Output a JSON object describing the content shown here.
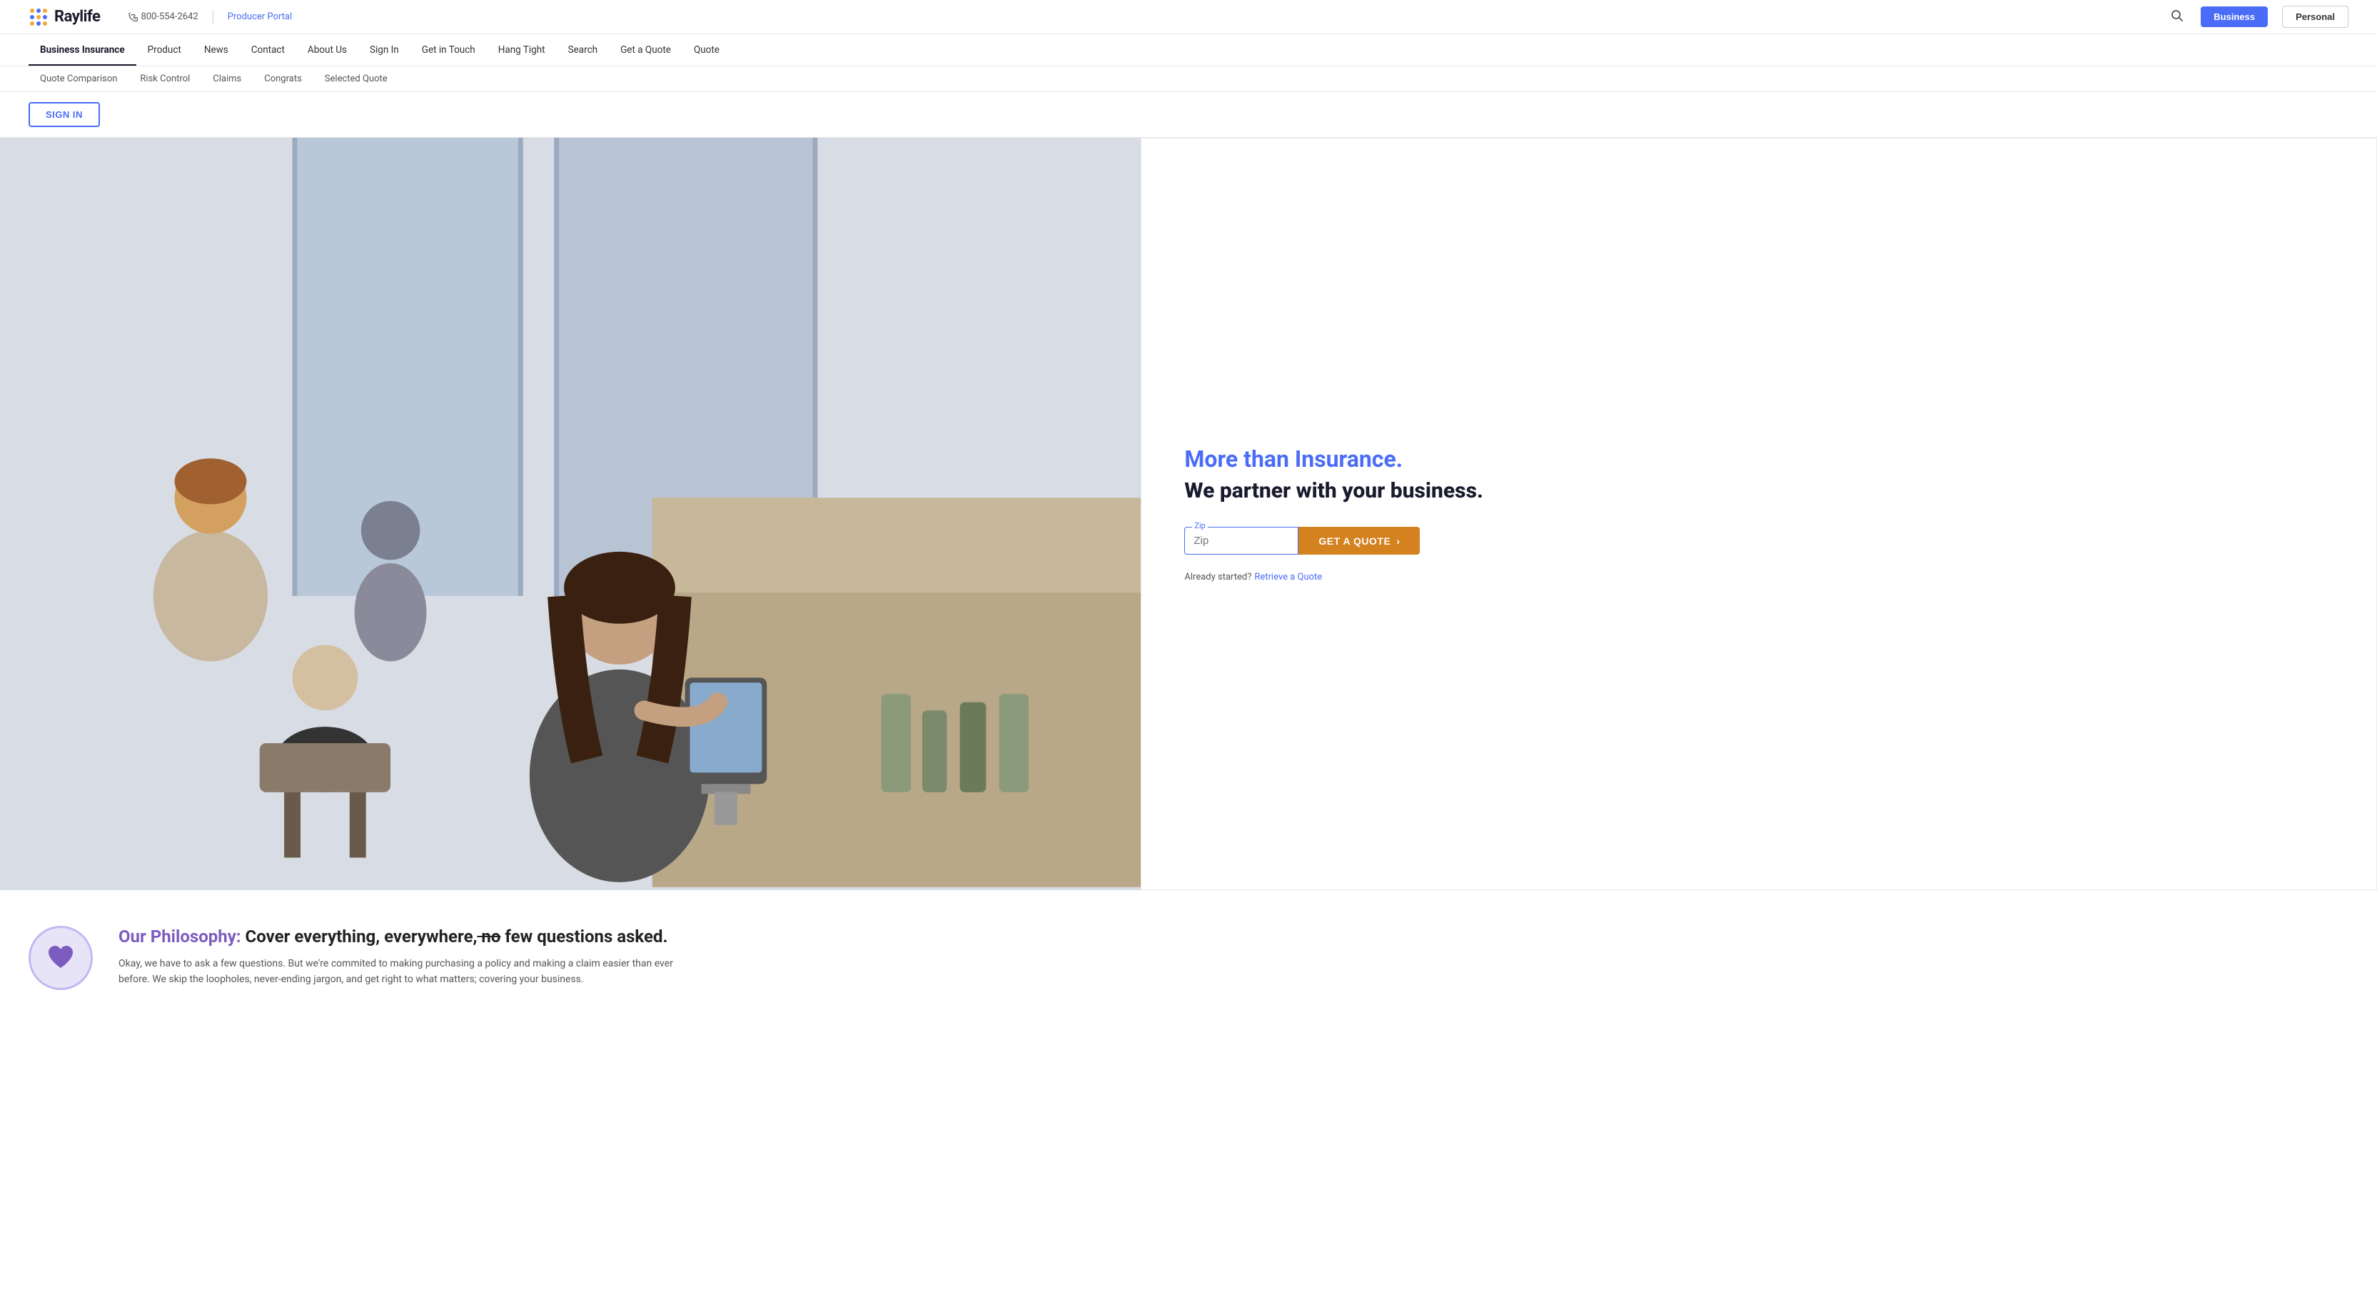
{
  "topBar": {
    "logoText": "Raylife",
    "phone": "800-554-2642",
    "producerPortal": "Producer Portal",
    "businessBtn": "Business",
    "personalBtn": "Personal"
  },
  "nav": {
    "items": [
      {
        "label": "Business Insurance",
        "active": true
      },
      {
        "label": "Product",
        "active": false
      },
      {
        "label": "News",
        "active": false
      },
      {
        "label": "Contact",
        "active": false
      },
      {
        "label": "About Us",
        "active": false
      },
      {
        "label": "Sign In",
        "active": false
      },
      {
        "label": "Get in Touch",
        "active": false
      },
      {
        "label": "Hang Tight",
        "active": false
      },
      {
        "label": "Search",
        "active": false
      },
      {
        "label": "Get a Quote",
        "active": false
      },
      {
        "label": "Quote",
        "active": false
      }
    ]
  },
  "subNav": {
    "items": [
      {
        "label": "Quote Comparison"
      },
      {
        "label": "Risk Control"
      },
      {
        "label": "Claims"
      },
      {
        "label": "Congrats"
      },
      {
        "label": "Selected Quote"
      }
    ]
  },
  "signIn": {
    "btnLabel": "SIGN IN"
  },
  "hero": {
    "tagline": "More than Insurance.",
    "subtitle": "We partner with your business.",
    "zipLabel": "Zip",
    "zipPlaceholder": "Zip",
    "getQuoteBtn": "GET A QUOTE",
    "alreadyStarted": "Already started?",
    "retrieveLink": "Retrieve a Quote"
  },
  "philosophy": {
    "titleColored": "Our Philosophy:",
    "titleMain": " Cover everything, everywhere,",
    "titleStrike": " no",
    "titleEnd": " few questions asked.",
    "description": "Okay, we have to ask a few questions. But we're commited to making purchasing a policy and making a claim easier than ever before. We skip the loopholes, never-ending jargon, and get right to what matters; covering your business."
  }
}
